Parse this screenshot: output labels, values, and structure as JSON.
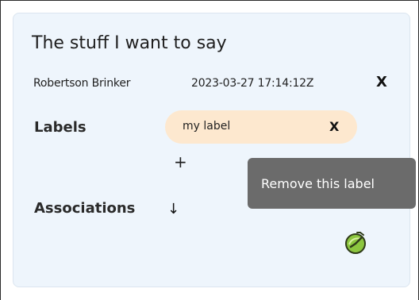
{
  "note": {
    "title": "The stuff I want to say",
    "author": "Robertson Brinker",
    "timestamp": "2023-03-27 17:14:12Z",
    "close_label": "X"
  },
  "labels": {
    "heading": "Labels",
    "items": [
      {
        "label": "my label",
        "remove_label": "X"
      }
    ],
    "add_label": "+"
  },
  "tooltip": {
    "text": "Remove this label"
  },
  "associations": {
    "heading": "Associations",
    "toggle_arrow": "↓"
  },
  "icons": {
    "status": "leaf-clock-icon"
  },
  "colors": {
    "card_background": "#eef5fc",
    "chip_background": "#fde8cf",
    "tooltip_background": "#6b6b6b",
    "status_icon_green": "#8cc63f"
  }
}
